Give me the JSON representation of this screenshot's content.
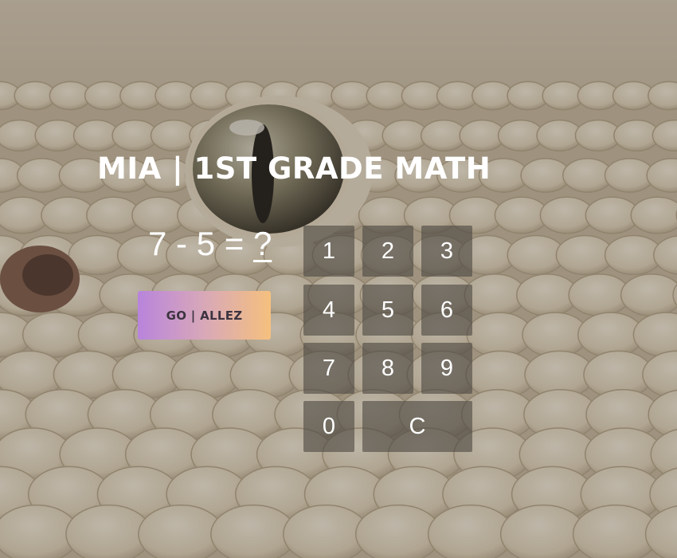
{
  "background": {
    "subject": "snake-eye-scales",
    "base_color": "#d9cdb6"
  },
  "app": {
    "title": "MIA | 1ST GRADE MATH"
  },
  "problem": {
    "operand_a": "7",
    "operator": "-",
    "operand_b": "5",
    "equals": "=",
    "answer": "?"
  },
  "actions": {
    "go_label": "GO | ALLEZ",
    "gradient": [
      "#b884dc",
      "#f5c07e"
    ]
  },
  "keypad": {
    "key_1": "1",
    "key_2": "2",
    "key_3": "3",
    "key_4": "4",
    "key_5": "5",
    "key_6": "6",
    "key_7": "7",
    "key_8": "8",
    "key_9": "9",
    "key_0": "0",
    "key_clear": "C"
  }
}
